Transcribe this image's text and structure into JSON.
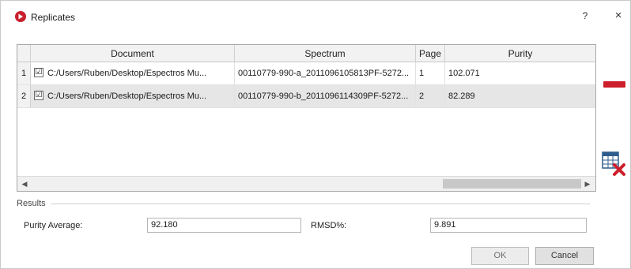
{
  "window": {
    "title": "Replicates",
    "help_label": "?",
    "close_label": "×"
  },
  "table": {
    "columns": [
      "Document",
      "Spectrum",
      "Page",
      "Purity"
    ],
    "rows": [
      {
        "num": "1",
        "checked": "☑",
        "document": "C:/Users/Ruben/Desktop/Espectros Mu...",
        "spectrum": "00110779-990-a_2011096105813PF-5272...",
        "page": "1",
        "purity": "102.071"
      },
      {
        "num": "2",
        "checked": "☑",
        "document": "C:/Users/Ruben/Desktop/Espectros Mu...",
        "spectrum": "00110779-990-b_2011096114309PF-5272...",
        "page": "2",
        "purity": "82.289"
      }
    ]
  },
  "results": {
    "section_label": "Results",
    "purity_average_label": "Purity Average:",
    "purity_average_value": "92.180",
    "rmsd_label": "RMSD%:",
    "rmsd_value": "9.891"
  },
  "buttons": {
    "ok": "OK",
    "cancel": "Cancel"
  },
  "colors": {
    "accent_red": "#cc1f2b",
    "selected_row": "#e6e6e6",
    "header_bg": "#f2f2f2"
  },
  "icons": [
    "app-logo-icon",
    "minus-icon",
    "delete-table-icon",
    "scroll-left-icon",
    "scroll-right-icon"
  ]
}
